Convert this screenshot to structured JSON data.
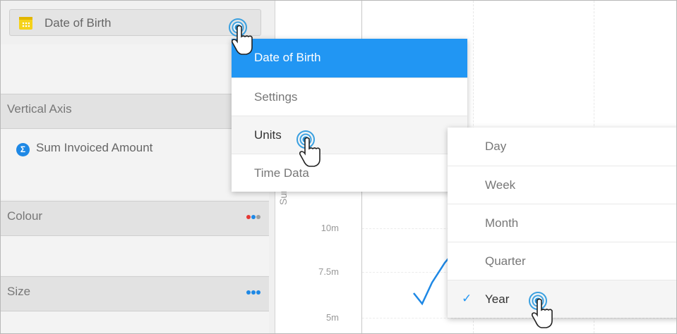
{
  "left_panel": {
    "date_field": {
      "label": "Date of Birth",
      "icon": "calendar-icon"
    },
    "vertical_axis": {
      "title": "Vertical Axis",
      "field": "Sum Invoiced Amount",
      "icon": "sigma-icon"
    },
    "colour": {
      "title": "Colour",
      "dots": [
        "#e53935",
        "#1e88e5",
        "#9e9e9e"
      ]
    },
    "size": {
      "title": "Size",
      "dots": [
        "#1e88e5",
        "#1e88e5",
        "#1e88e5"
      ]
    }
  },
  "chart": {
    "y_axis_title": "Sum Invoic",
    "y_ticks": [
      "10m",
      "7.5m",
      "5m"
    ]
  },
  "context_menu": {
    "header": "Date of Birth",
    "items": [
      "Settings",
      "Units",
      "Time Data"
    ],
    "active": "Units"
  },
  "units_submenu": {
    "items": [
      "Day",
      "Week",
      "Month",
      "Quarter",
      "Year"
    ],
    "selected": "Year"
  },
  "colors": {
    "accent": "#2196f3",
    "menu_header": "#2196f3"
  }
}
